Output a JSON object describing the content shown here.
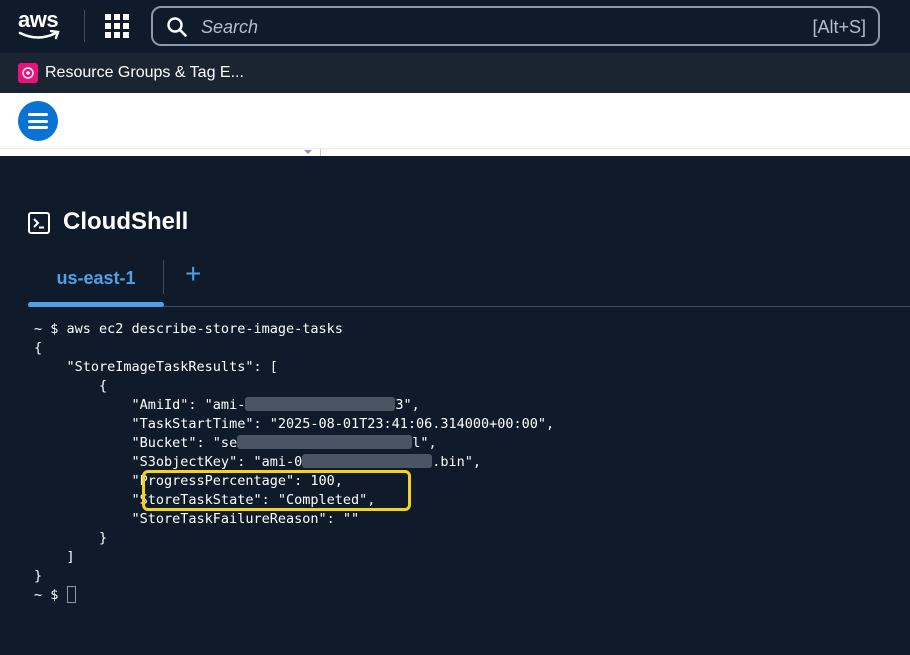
{
  "nav": {
    "logo_text": "aws",
    "search_placeholder": "Search",
    "search_shortcut": "[Alt+S]"
  },
  "favorites": {
    "item_label": "Resource Groups & Tag E..."
  },
  "cloudshell": {
    "title": "CloudShell",
    "tab_label": "us-east-1",
    "add_tab_glyph": "+"
  },
  "terminal": {
    "line1": "~ $ aws ec2 describe-store-image-tasks",
    "line2": "{",
    "line3": "    \"StoreImageTaskResults\": [",
    "line4": "        {",
    "line5_a": "            \"AmiId\": \"ami-",
    "line5_b": "3\",",
    "line6": "            \"TaskStartTime\": \"2025-08-01T23:41:06.314000+00:00\",",
    "line7_a": "            \"Bucket\": \"se",
    "line7_b": "l\",",
    "line8_a": "            \"S3objectKey\": \"ami-0",
    "line8_b": ".bin\",",
    "line9": "            \"ProgressPercentage\": 100,",
    "line10": "            \"StoreTaskState\": \"Completed\",",
    "line11": "            \"StoreTaskFailureReason\": \"\"",
    "line12": "        }",
    "line13": "    ]",
    "line14": "}",
    "prompt": "~ $ "
  },
  "colors": {
    "background": "#0f1b2a",
    "accent": "#539fe5",
    "highlight": "#f5d21e",
    "menu_button": "#0972d3"
  },
  "icons": [
    "grid-icon",
    "search-icon",
    "resource-groups-icon",
    "menu-icon",
    "terminal-icon",
    "add-icon"
  ]
}
